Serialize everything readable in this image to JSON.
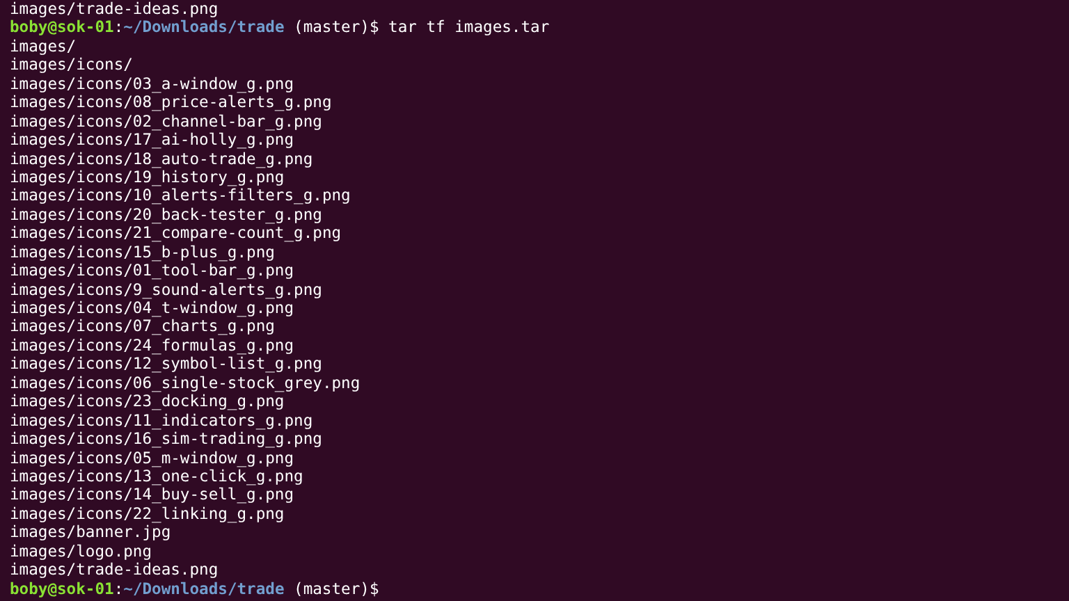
{
  "terminal": {
    "lines": [
      {
        "kind": "output",
        "text": "images/trade-ideas.png"
      },
      {
        "kind": "prompt",
        "user_host": "boby@sok-01",
        "separator": ":",
        "path": "~/Downloads/trade",
        "branch": "(master)$",
        "command": "tar tf images.tar"
      },
      {
        "kind": "output",
        "text": "images/"
      },
      {
        "kind": "output",
        "text": "images/icons/"
      },
      {
        "kind": "output",
        "text": "images/icons/03_a-window_g.png"
      },
      {
        "kind": "output",
        "text": "images/icons/08_price-alerts_g.png"
      },
      {
        "kind": "output",
        "text": "images/icons/02_channel-bar_g.png"
      },
      {
        "kind": "output",
        "text": "images/icons/17_ai-holly_g.png"
      },
      {
        "kind": "output",
        "text": "images/icons/18_auto-trade_g.png"
      },
      {
        "kind": "output",
        "text": "images/icons/19_history_g.png"
      },
      {
        "kind": "output",
        "text": "images/icons/10_alerts-filters_g.png"
      },
      {
        "kind": "output",
        "text": "images/icons/20_back-tester_g.png"
      },
      {
        "kind": "output",
        "text": "images/icons/21_compare-count_g.png"
      },
      {
        "kind": "output",
        "text": "images/icons/15_b-plus_g.png"
      },
      {
        "kind": "output",
        "text": "images/icons/01_tool-bar_g.png"
      },
      {
        "kind": "output",
        "text": "images/icons/9_sound-alerts_g.png"
      },
      {
        "kind": "output",
        "text": "images/icons/04_t-window_g.png"
      },
      {
        "kind": "output",
        "text": "images/icons/07_charts_g.png"
      },
      {
        "kind": "output",
        "text": "images/icons/24_formulas_g.png"
      },
      {
        "kind": "output",
        "text": "images/icons/12_symbol-list_g.png"
      },
      {
        "kind": "output",
        "text": "images/icons/06_single-stock_grey.png"
      },
      {
        "kind": "output",
        "text": "images/icons/23_docking_g.png"
      },
      {
        "kind": "output",
        "text": "images/icons/11_indicators_g.png"
      },
      {
        "kind": "output",
        "text": "images/icons/16_sim-trading_g.png"
      },
      {
        "kind": "output",
        "text": "images/icons/05_m-window_g.png"
      },
      {
        "kind": "output",
        "text": "images/icons/13_one-click_g.png"
      },
      {
        "kind": "output",
        "text": "images/icons/14_buy-sell_g.png"
      },
      {
        "kind": "output",
        "text": "images/icons/22_linking_g.png"
      },
      {
        "kind": "output",
        "text": "images/banner.jpg"
      },
      {
        "kind": "output",
        "text": "images/logo.png"
      },
      {
        "kind": "output",
        "text": "images/trade-ideas.png"
      },
      {
        "kind": "prompt",
        "user_host": "boby@sok-01",
        "separator": ":",
        "path": "~/Downloads/trade",
        "branch": "(master)$"
      }
    ]
  }
}
